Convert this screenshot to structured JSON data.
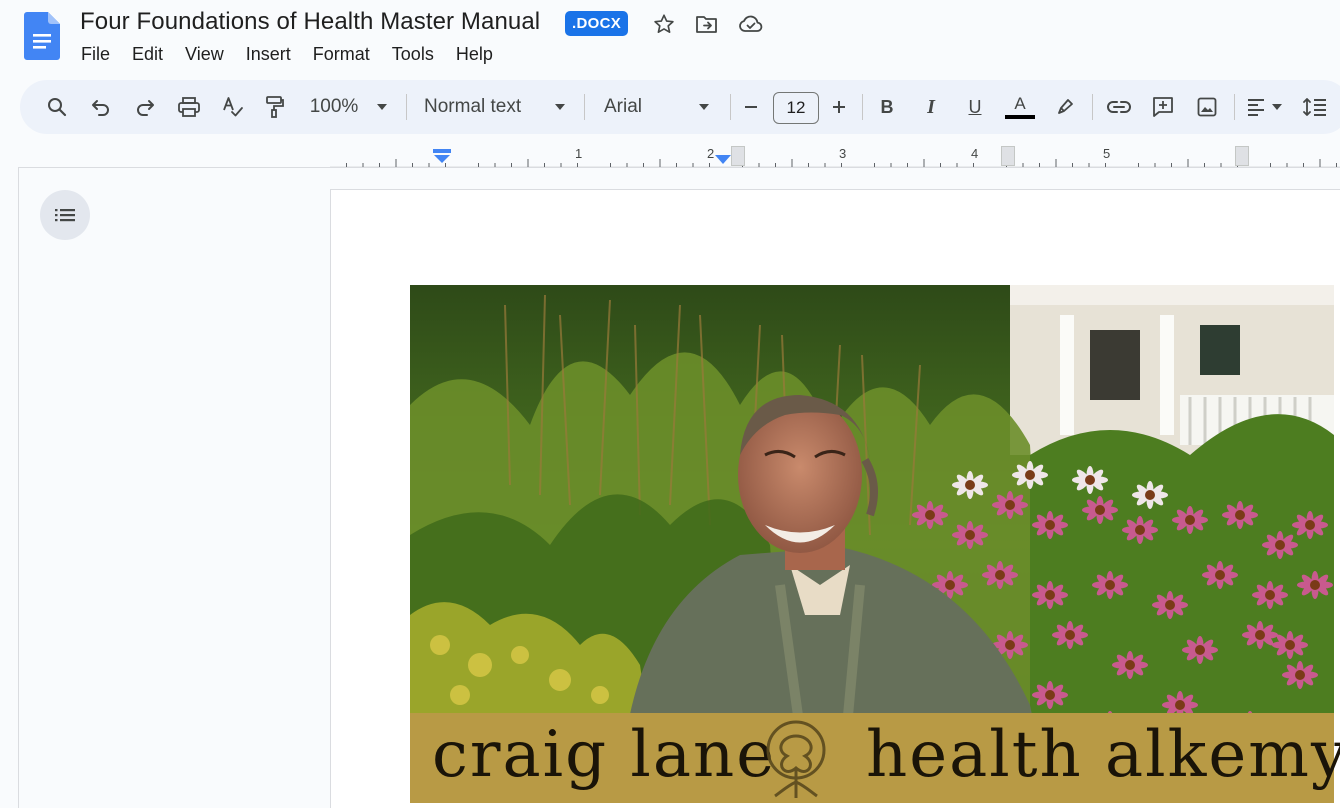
{
  "document": {
    "title": "Four Foundations of Health Master Manual",
    "format_badge": ".DOCX"
  },
  "menu": [
    "File",
    "Edit",
    "View",
    "Insert",
    "Format",
    "Tools",
    "Help"
  ],
  "toolbar": {
    "zoom": "100%",
    "style": "Normal text",
    "font": "Arial",
    "font_size": "12",
    "bold": "B",
    "italic": "I",
    "underline": "U",
    "text_color_letter": "A",
    "text_color": "#000000"
  },
  "ruler": {
    "numbers": [
      "1",
      "2",
      "3",
      "4",
      "5"
    ]
  },
  "banner": {
    "left_text": "craig lane",
    "right_text": "health alkemy",
    "color": "#b89a45"
  },
  "colors": {
    "accent": "#1a73e8",
    "toolbar_bg": "#edf2fa",
    "page_bg": "#f9fbfd"
  }
}
